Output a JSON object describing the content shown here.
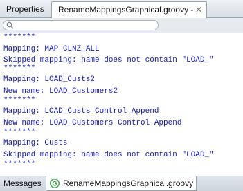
{
  "tabs": {
    "properties": "Properties",
    "log": "RenameMappingsGraphical.groovy - Log"
  },
  "icons": {
    "close": "close-icon",
    "search": "search-icon",
    "groovy": "groovy-file-icon"
  },
  "colors": {
    "log_text": "#1219c7",
    "groovy_icon": "#3aa546"
  },
  "log_lines": [
    "*******",
    "Mapping: MAP_CLNZ_ALL",
    "Skipped mapping: name does not contain \"LOAD_\"",
    "*******",
    "Mapping: LOAD_Custs2",
    "New name: LOAD_Customers2",
    "*******",
    "Mapping: LOAD_Custs Control Append",
    "New name: LOAD_Customers Control Append",
    "*******",
    "Mapping: Custs",
    "Skipped mapping: name does not contain \"LOAD_\"",
    "*******"
  ],
  "bottom_tabs": {
    "messages": "Messages",
    "groovy": "RenameMappingsGraphical.groovy"
  }
}
